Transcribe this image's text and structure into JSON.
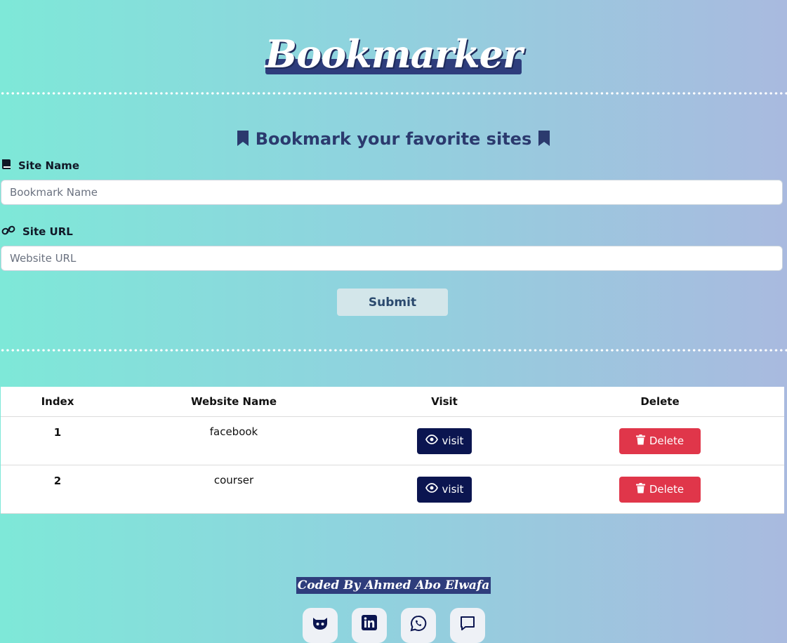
{
  "header": {
    "title": "Bookmarker",
    "subtitle": "Bookmark your favorite sites"
  },
  "form": {
    "site_name_label": "Site Name",
    "site_name_placeholder": "Bookmark Name",
    "site_url_label": "Site URL",
    "site_url_placeholder": "Website URL",
    "submit_label": "Submit"
  },
  "table": {
    "headers": [
      "Index",
      "Website Name",
      "Visit",
      "Delete"
    ],
    "rows": [
      {
        "index": "1",
        "name": "facebook",
        "visit_label": "visit",
        "delete_label": "Delete"
      },
      {
        "index": "2",
        "name": "courser",
        "visit_label": "visit",
        "delete_label": "Delete"
      }
    ]
  },
  "footer": {
    "credit": "Coded By Ahmed Abo Elwafa",
    "socials": [
      "github-icon",
      "linkedin-icon",
      "whatsapp-icon",
      "message-icon"
    ]
  },
  "colors": {
    "visit_button": "#0b1550",
    "delete_button": "#e0364a",
    "heading": "#2b3a6e"
  }
}
